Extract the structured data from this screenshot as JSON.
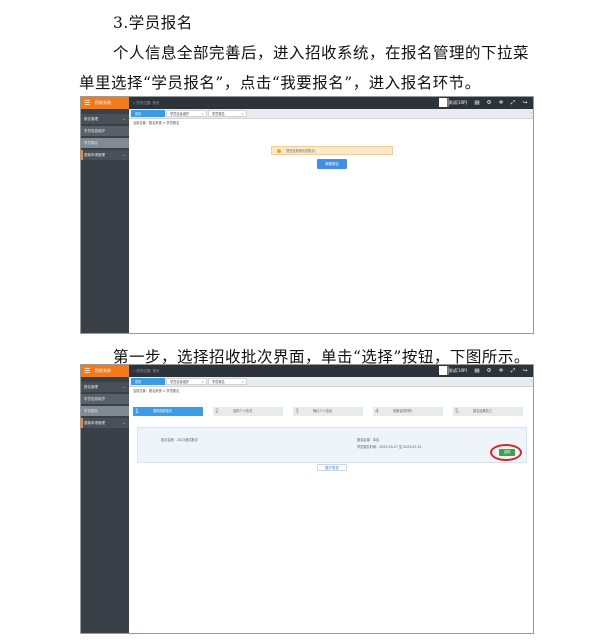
{
  "document": {
    "heading": "3.学员报名",
    "intro_line1": "个人信息全部完善后，进入招收系统，在报名管理的下拉菜",
    "intro_line2": "单里选择“学员报名”，点击“我要报名”，进入报名环节。",
    "step1_text": "第一步，选择招收批次界面，单击“选择”按钮，下图所示。"
  },
  "app": {
    "brand": "招收系统",
    "top_breadcrumb": "» 您的位置: 首页",
    "user_name": "测试[10P]",
    "top_icons": [
      "document-icon",
      "settings-icon",
      "gear-icon",
      "expand-icon",
      "logout-icon"
    ],
    "tabs": [
      "首页",
      "学员信息维护",
      "学员报名"
    ],
    "page_breadcrumb": "当前位置：报名系统 > 学员报名",
    "sidebar": [
      {
        "label": "报名管理",
        "kind": "top"
      },
      {
        "label": "学员信息维护",
        "kind": "sub"
      },
      {
        "label": "学员报名",
        "kind": "active"
      },
      {
        "label": "退款申请管理",
        "kind": "other"
      }
    ],
    "colors": {
      "brand": "#f27a1a",
      "topbar": "#2d333a",
      "sidebar": "#3a4047",
      "accent": "#3c9be5",
      "select_button": "#3fa34a",
      "highlight_circle": "#d8262a"
    }
  },
  "shot1": {
    "notice": "您还没有报名的批次。",
    "apply_button": "我要报名"
  },
  "shot2": {
    "steps": [
      {
        "num": "1",
        "label": "选择招收批次"
      },
      {
        "num": "2",
        "label": "选择个人情况"
      },
      {
        "num": "3",
        "label": "确认个人信息"
      },
      {
        "num": "4",
        "label": "资格证明材料"
      },
      {
        "num": "5",
        "label": "报名结果告之"
      }
    ],
    "batch_name": "批次名称：2023测试批次",
    "region": "报名区域：本区",
    "period": "学员报名时间：2023-03-27 至 2023-03-31",
    "select_button": "选择",
    "more_button": "展开更多"
  }
}
